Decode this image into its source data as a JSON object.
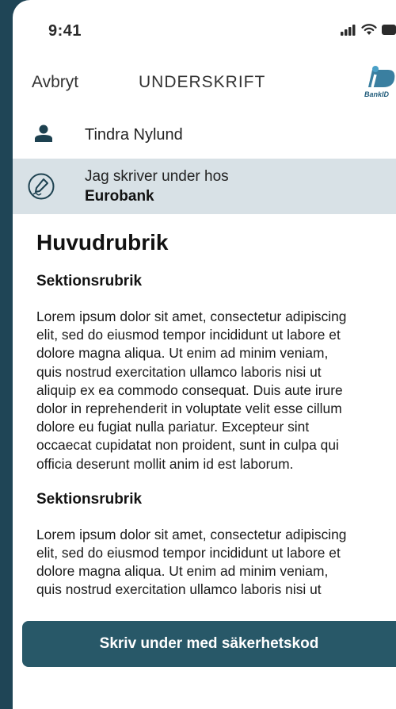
{
  "status_bar": {
    "time": "9:41"
  },
  "nav": {
    "cancel_label": "Avbryt",
    "title": "UNDERSKRIFT",
    "logo_text": "BankID"
  },
  "signer": {
    "name": "Tindra Nylund"
  },
  "signing": {
    "line1": "Jag skriver under hos",
    "line2": "Eurobank"
  },
  "document": {
    "title": "Huvudrubrik",
    "sections": [
      {
        "heading": "Sektionsrubrik",
        "lines": [
          "Lorem ipsum dolor sit amet, consectetur adipiscing",
          "elit, sed do eiusmod tempor incididunt ut labore et",
          "dolore magna aliqua. Ut enim ad minim veniam,",
          "quis nostrud exercitation ullamco laboris nisi ut",
          "aliquip ex ea commodo consequat. Duis aute irure",
          "dolor in reprehenderit in voluptate velit esse cillum",
          "dolore eu fugiat nulla pariatur. Excepteur sint",
          "occaecat cupidatat non proident, sunt in culpa qui",
          "officia deserunt mollit anim id est laborum."
        ]
      },
      {
        "heading": "Sektionsrubrik",
        "lines": [
          "Lorem ipsum dolor sit amet, consectetur adipiscing",
          "elit, sed do eiusmod tempor incididunt ut labore et",
          "dolore magna aliqua. Ut enim ad minim veniam,",
          "quis nostrud exercitation ullamco laboris nisi ut"
        ]
      }
    ]
  },
  "action": {
    "sign_button_label": "Skriv under med säkerhetskod"
  },
  "colors": {
    "background": "#1f4556",
    "accent": "#285868",
    "signing_box": "#d8e1e6"
  }
}
